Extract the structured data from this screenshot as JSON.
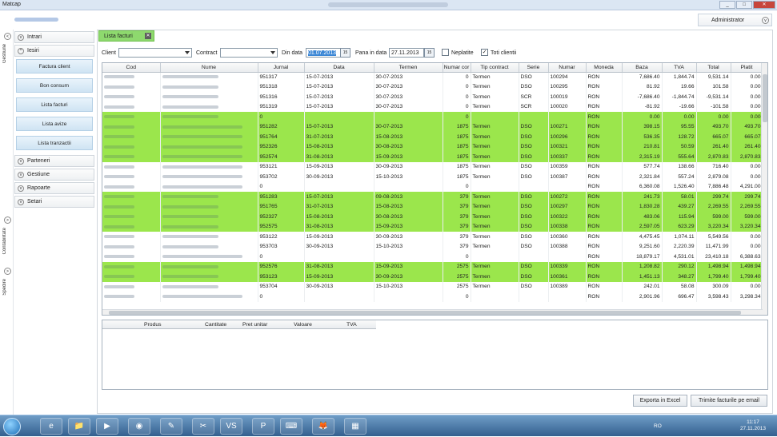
{
  "window": {
    "title": "Matcap",
    "buttons": [
      "_",
      "□",
      "✕"
    ]
  },
  "header": {
    "user": "Administrator"
  },
  "leftrail": {
    "labels": [
      "Gestiune",
      "Contabilitate",
      "Spedire"
    ]
  },
  "nav": {
    "groups": [
      "Intrari",
      "Iesiri",
      "Parteneri",
      "Gestiune",
      "Rapoarte",
      "Setari"
    ],
    "iesiri_items": [
      "Factura client",
      "Bon consum",
      "Lista facturi",
      "Lista avize",
      "Lista tranzactii"
    ]
  },
  "tab": {
    "label": "Lista facturi"
  },
  "filters": {
    "client_label": "Client",
    "contract_label": "Contract",
    "from_label": "Din data",
    "from_value": "01.07.2013",
    "to_label": "Pana in data",
    "to_value": "27.11.2013",
    "unpaid_label": "Neplatite",
    "unpaid_checked": "",
    "allclients_label": "Toti clientii",
    "allclients_checked": "✓",
    "cal_icon": "15"
  },
  "grid": {
    "columns": [
      "Cod",
      "Nume",
      "Jurnal",
      "Data",
      "Termen",
      "Numar cor",
      "Tip contract",
      "Serie",
      "Numar",
      "Moneda",
      "Baza",
      "TVA",
      "Total",
      "Platit"
    ],
    "rows": [
      {
        "g": false,
        "c": "AIDATRANS",
        "n": "AIDATRANS COM",
        "j": "951317",
        "d": "15-07-2013",
        "t": "30-07-2013",
        "nc": "0",
        "tc": "Termen",
        "s": "DSO",
        "nr": "100294",
        "m": "RON",
        "b": "7,686.40",
        "v": "1,844.74",
        "tot": "9,531.14",
        "p": "0.00"
      },
      {
        "g": false,
        "c": "AIDATRANS",
        "n": "AIDATRANS COM",
        "j": "951318",
        "d": "15-07-2013",
        "t": "30-07-2013",
        "nc": "0",
        "tc": "Termen",
        "s": "DSO",
        "nr": "100295",
        "m": "RON",
        "b": "81.92",
        "v": "19.66",
        "tot": "101.58",
        "p": "0.00"
      },
      {
        "g": false,
        "c": "AIDATRANS",
        "n": "AIDATRANS COM",
        "j": "951316",
        "d": "15-07-2013",
        "t": "30-07-2013",
        "nc": "0",
        "tc": "Termen",
        "s": "SCR",
        "nr": "100019",
        "m": "RON",
        "b": "-7,686.40",
        "v": "-1,844.74",
        "tot": "-9,531.14",
        "p": "0.00"
      },
      {
        "g": false,
        "c": "AIDATRANS",
        "n": "AIDATRANS COM",
        "j": "951319",
        "d": "15-07-2013",
        "t": "30-07-2013",
        "nc": "0",
        "tc": "Termen",
        "s": "SCR",
        "nr": "100020",
        "m": "RON",
        "b": "-81.92",
        "v": "-19.66",
        "tot": "-101.58",
        "p": "0.00"
      },
      {
        "g": true,
        "c": "AIDATRANS",
        "n": "AIDATRANS COM TOTAL",
        "j": "0",
        "d": "",
        "t": "",
        "nc": "0",
        "tc": "",
        "s": "",
        "nr": "",
        "m": "RON",
        "b": "0.00",
        "v": "0.00",
        "tot": "0.00",
        "p": "0.00"
      },
      {
        "g": true,
        "c": "ALECOR",
        "n": "S.C ALECOR SPEDITION S.R.L",
        "j": "951282",
        "d": "15-07-2013",
        "t": "30-07-2013",
        "nc": "1875",
        "tc": "Termen",
        "s": "DSO",
        "nr": "100271",
        "m": "RON",
        "b": "398.15",
        "v": "95.55",
        "tot": "493.70",
        "p": "493.70"
      },
      {
        "g": true,
        "c": "ALECOR",
        "n": "S.C ALECOR SPEDITION S.R.L",
        "j": "951764",
        "d": "31-07-2013",
        "t": "15-08-2013",
        "nc": "1875",
        "tc": "Termen",
        "s": "DSO",
        "nr": "100296",
        "m": "RON",
        "b": "536.35",
        "v": "128.72",
        "tot": "665.07",
        "p": "665.07"
      },
      {
        "g": true,
        "c": "ALECOR",
        "n": "S.C ALECOR SPEDITION S.R.L",
        "j": "952326",
        "d": "15-08-2013",
        "t": "30-08-2013",
        "nc": "1875",
        "tc": "Termen",
        "s": "DSO",
        "nr": "100321",
        "m": "RON",
        "b": "210.81",
        "v": "50.59",
        "tot": "261.40",
        "p": "261.40"
      },
      {
        "g": true,
        "c": "ALECOR",
        "n": "S.C ALECOR SPEDITION S.R.L",
        "j": "952574",
        "d": "31-08-2013",
        "t": "15-09-2013",
        "nc": "1875",
        "tc": "Termen",
        "s": "DSO",
        "nr": "100337",
        "m": "RON",
        "b": "2,315.19",
        "v": "555.64",
        "tot": "2,870.83",
        "p": "2,870.83"
      },
      {
        "g": false,
        "c": "ALECOR",
        "n": "S.C ALECOR SPEDITION S.R.L",
        "j": "953121",
        "d": "15-09-2013",
        "t": "30-09-2013",
        "nc": "1875",
        "tc": "Termen",
        "s": "DSO",
        "nr": "100359",
        "m": "RON",
        "b": "577.74",
        "v": "138.66",
        "tot": "716.40",
        "p": "0.00"
      },
      {
        "g": false,
        "c": "ALECOR",
        "n": "S.C ALECOR SPEDITION S.R.L",
        "j": "953702",
        "d": "30-09-2013",
        "t": "15-10-2013",
        "nc": "1875",
        "tc": "Termen",
        "s": "DSO",
        "nr": "100387",
        "m": "RON",
        "b": "2,321.84",
        "v": "557.24",
        "tot": "2,879.08",
        "p": "0.00"
      },
      {
        "g": false,
        "c": "ALECOR",
        "n": "S.C ALECOR SPEDITION S.R.L TOTAL",
        "j": "0",
        "d": "",
        "t": "",
        "nc": "0",
        "tc": "",
        "s": "",
        "nr": "",
        "m": "RON",
        "b": "6,360.08",
        "v": "1,526.40",
        "tot": "7,886.48",
        "p": "4,291.00"
      },
      {
        "g": true,
        "c": "AMD",
        "n": "S.C AMEDAMARU S.R.L",
        "j": "951283",
        "d": "15-07-2013",
        "t": "09-08-2013",
        "nc": "379",
        "tc": "Termen",
        "s": "DSO",
        "nr": "100272",
        "m": "RON",
        "b": "241.73",
        "v": "58.01",
        "tot": "299.74",
        "p": "299.74"
      },
      {
        "g": true,
        "c": "AMD",
        "n": "S.C AMEDAMARU S.R.L",
        "j": "951765",
        "d": "31-07-2013",
        "t": "15-08-2013",
        "nc": "379",
        "tc": "Termen",
        "s": "DSO",
        "nr": "100297",
        "m": "RON",
        "b": "1,830.28",
        "v": "439.27",
        "tot": "2,269.55",
        "p": "2,269.55"
      },
      {
        "g": true,
        "c": "AMD",
        "n": "S.C AMEDAMARU S.R.L",
        "j": "952327",
        "d": "15-08-2013",
        "t": "30-08-2013",
        "nc": "379",
        "tc": "Termen",
        "s": "DSO",
        "nr": "100322",
        "m": "RON",
        "b": "483.06",
        "v": "115.94",
        "tot": "599.00",
        "p": "599.00"
      },
      {
        "g": true,
        "c": "AMD",
        "n": "S.C AMEDAMARU S.R.L",
        "j": "952575",
        "d": "31-08-2013",
        "t": "15-09-2013",
        "nc": "379",
        "tc": "Termen",
        "s": "DSO",
        "nr": "100338",
        "m": "RON",
        "b": "2,597.05",
        "v": "623.29",
        "tot": "3,220.34",
        "p": "3,220.34"
      },
      {
        "g": false,
        "c": "AMD",
        "n": "S.C AMEDAMARU S.R.L",
        "j": "953122",
        "d": "15-09-2013",
        "t": "30-09-2013",
        "nc": "379",
        "tc": "Termen",
        "s": "DSO",
        "nr": "100360",
        "m": "RON",
        "b": "4,475.45",
        "v": "1,074.11",
        "tot": "5,549.56",
        "p": "0.00"
      },
      {
        "g": false,
        "c": "AMD",
        "n": "S.C AMEDAMARU S.R.L",
        "j": "953703",
        "d": "30-09-2013",
        "t": "15-10-2013",
        "nc": "379",
        "tc": "Termen",
        "s": "DSO",
        "nr": "100388",
        "m": "RON",
        "b": "9,251.60",
        "v": "2,220.39",
        "tot": "11,471.99",
        "p": "0.00"
      },
      {
        "g": false,
        "c": "AMD",
        "n": "S.C AMEDAMARU S.R.L TOTAL",
        "j": "0",
        "d": "",
        "t": "",
        "nc": "0",
        "tc": "",
        "s": "",
        "nr": "",
        "m": "RON",
        "b": "18,879.17",
        "v": "4,531.01",
        "tot": "23,410.18",
        "p": "6,388.63"
      },
      {
        "g": true,
        "c": "ANA",
        "n": "S.C ANA&DORU TRANS S.R.L",
        "j": "952576",
        "d": "31-08-2013",
        "t": "15-09-2013",
        "nc": "2575",
        "tc": "Termen",
        "s": "DSO",
        "nr": "100339",
        "m": "RON",
        "b": "1,208.82",
        "v": "290.12",
        "tot": "1,498.94",
        "p": "1,498.94"
      },
      {
        "g": true,
        "c": "ANA",
        "n": "S.C ANA&DORU TRANS S.R.L",
        "j": "953123",
        "d": "15-09-2013",
        "t": "30-09-2013",
        "nc": "2575",
        "tc": "Termen",
        "s": "DSO",
        "nr": "100361",
        "m": "RON",
        "b": "1,451.13",
        "v": "348.27",
        "tot": "1,799.40",
        "p": "1,799.40"
      },
      {
        "g": false,
        "c": "ANA",
        "n": "S.C ANA&DORU TRANS S.R.L",
        "j": "953704",
        "d": "30-09-2013",
        "t": "15-10-2013",
        "nc": "2575",
        "tc": "Termen",
        "s": "DSO",
        "nr": "100389",
        "m": "RON",
        "b": "242.01",
        "v": "58.08",
        "tot": "300.09",
        "p": "0.00"
      },
      {
        "g": false,
        "c": "ANA",
        "n": "S.C ANA&DORU TRANS S.R.L TOTAL",
        "j": "0",
        "d": "",
        "t": "",
        "nc": "0",
        "tc": "",
        "s": "",
        "nr": "",
        "m": "RON",
        "b": "2,901.96",
        "v": "696.47",
        "tot": "3,598.43",
        "p": "3,298.34"
      }
    ]
  },
  "detail": {
    "columns": [
      "Produs",
      "Cantitate",
      "Pret unitar",
      "Valoare",
      "TVA"
    ]
  },
  "actions": {
    "export": "Exporta in Excel",
    "email": "Trimite facturile pe email"
  },
  "taskbar": {
    "lang": "RO",
    "time": "11:17",
    "date": "27.11.2013",
    "icons": [
      "e",
      "📁",
      "▶",
      "◉",
      "✎",
      "✂",
      "VS",
      "P",
      "⌨",
      "🦊",
      "▦"
    ]
  }
}
